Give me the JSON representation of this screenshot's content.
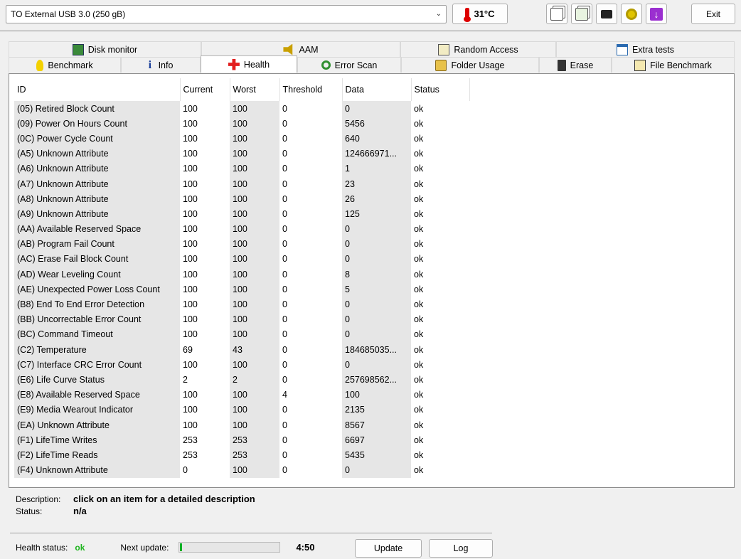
{
  "device": {
    "selected": "TO External USB 3.0 (250 gB)"
  },
  "temperature": "31°C",
  "toolbar": {
    "exit_label": "Exit"
  },
  "tabs": {
    "row1": [
      {
        "label": "Disk monitor",
        "icon": "disk-monitor-icon"
      },
      {
        "label": "AAM",
        "icon": "speaker-icon"
      },
      {
        "label": "Random Access",
        "icon": "random-access-icon"
      },
      {
        "label": "Extra tests",
        "icon": "extra-tests-icon"
      }
    ],
    "row2": [
      {
        "label": "Benchmark",
        "icon": "lightbulb-icon"
      },
      {
        "label": "Info",
        "icon": "info-icon"
      },
      {
        "label": "Health",
        "icon": "health-cross-icon"
      },
      {
        "label": "Error Scan",
        "icon": "magnifier-icon"
      },
      {
        "label": "Folder Usage",
        "icon": "folder-icon"
      },
      {
        "label": "Erase",
        "icon": "trash-icon"
      },
      {
        "label": "File Benchmark",
        "icon": "file-benchmark-icon"
      }
    ],
    "active": "Health"
  },
  "table": {
    "headers": [
      "ID",
      "Current",
      "Worst",
      "Threshold",
      "Data",
      "Status"
    ],
    "rows": [
      [
        "(05) Retired Block Count",
        "100",
        "100",
        "0",
        "0",
        "ok"
      ],
      [
        "(09) Power On Hours Count",
        "100",
        "100",
        "0",
        "5456",
        "ok"
      ],
      [
        "(0C) Power Cycle Count",
        "100",
        "100",
        "0",
        "640",
        "ok"
      ],
      [
        "(A5) Unknown Attribute",
        "100",
        "100",
        "0",
        "124666971...",
        "ok"
      ],
      [
        "(A6) Unknown Attribute",
        "100",
        "100",
        "0",
        "1",
        "ok"
      ],
      [
        "(A7) Unknown Attribute",
        "100",
        "100",
        "0",
        "23",
        "ok"
      ],
      [
        "(A8) Unknown Attribute",
        "100",
        "100",
        "0",
        "26",
        "ok"
      ],
      [
        "(A9) Unknown Attribute",
        "100",
        "100",
        "0",
        "125",
        "ok"
      ],
      [
        "(AA) Available Reserved Space",
        "100",
        "100",
        "0",
        "0",
        "ok"
      ],
      [
        "(AB) Program Fail Count",
        "100",
        "100",
        "0",
        "0",
        "ok"
      ],
      [
        "(AC) Erase Fail Block Count",
        "100",
        "100",
        "0",
        "0",
        "ok"
      ],
      [
        "(AD) Wear Leveling Count",
        "100",
        "100",
        "0",
        "8",
        "ok"
      ],
      [
        "(AE) Unexpected Power Loss Count",
        "100",
        "100",
        "0",
        "5",
        "ok"
      ],
      [
        "(B8) End To End Error Detection",
        "100",
        "100",
        "0",
        "0",
        "ok"
      ],
      [
        "(BB) Uncorrectable Error Count",
        "100",
        "100",
        "0",
        "0",
        "ok"
      ],
      [
        "(BC) Command Timeout",
        "100",
        "100",
        "0",
        "0",
        "ok"
      ],
      [
        "(C2) Temperature",
        "69",
        "43",
        "0",
        "184685035...",
        "ok"
      ],
      [
        "(C7) Interface CRC Error Count",
        "100",
        "100",
        "0",
        "0",
        "ok"
      ],
      [
        "(E6) Life Curve Status",
        "2",
        "2",
        "0",
        "257698562...",
        "ok"
      ],
      [
        "(E8) Available Reserved Space",
        "100",
        "100",
        "4",
        "100",
        "ok"
      ],
      [
        "(E9) Media Wearout Indicator",
        "100",
        "100",
        "0",
        "2135",
        "ok"
      ],
      [
        "(EA) Unknown Attribute",
        "100",
        "100",
        "0",
        "8567",
        "ok"
      ],
      [
        "(F1) LifeTime Writes",
        "253",
        "253",
        "0",
        "6697",
        "ok"
      ],
      [
        "(F2) LifeTime Reads",
        "253",
        "253",
        "0",
        "5435",
        "ok"
      ],
      [
        "(F4) Unknown Attribute",
        "0",
        "100",
        "0",
        "0",
        "ok"
      ]
    ]
  },
  "description": {
    "desc_label": "Description:",
    "desc_value": "click on an item for a detailed description",
    "status_label": "Status:",
    "status_value": "n/a"
  },
  "footer": {
    "health_label": "Health status:",
    "health_value": "ok",
    "next_update_label": "Next update:",
    "next_update_time": "4:50",
    "progress_fraction": 0.02,
    "update_label": "Update",
    "log_label": "Log"
  },
  "colors": {
    "health_ok": "#1fb41f",
    "progress_fill": "#06b025",
    "alt_column": "#e6e6e6"
  }
}
